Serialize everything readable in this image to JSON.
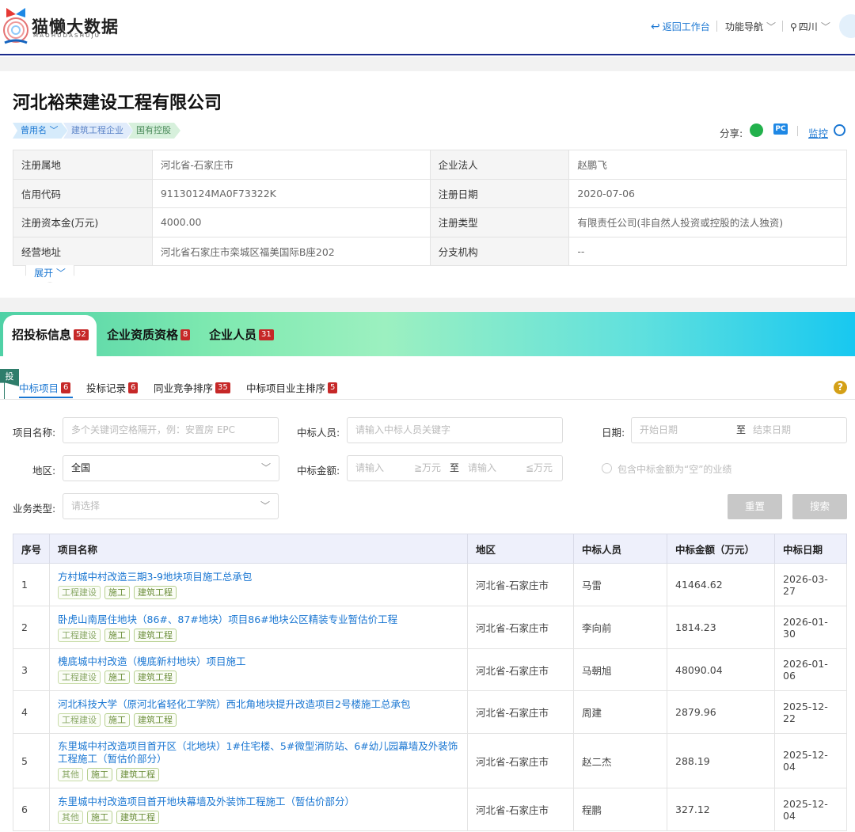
{
  "header": {
    "logo_text": "猫懒大数据",
    "logo_sub": "MAOHUDASHUJU",
    "back_label": "返回工作台",
    "nav_label": "功能导航",
    "region_label": "四川"
  },
  "company": {
    "name": "河北裕荣建设工程有限公司",
    "tags": [
      "曾用名",
      "建筑工程企业",
      "国有控股"
    ],
    "share_label": "分享:",
    "monitor_label": "监控",
    "pc_label": "PC",
    "info": [
      {
        "k1": "注册属地",
        "v1": "河北省-石家庄市",
        "k2": "企业法人",
        "v2": "赵鹏飞"
      },
      {
        "k1": "信用代码",
        "v1": "91130124MA0F73322K",
        "k2": "注册日期",
        "v2": "2020-07-06"
      },
      {
        "k1": "注册资本金(万元)",
        "v1": "4000.00",
        "k2": "注册类型",
        "v2": "有限责任公司(非自然人投资或控股的法人独资)"
      },
      {
        "k1": "经营地址",
        "v1": "河北省石家庄市栾城区福美国际B座202",
        "k2": "分支机构",
        "v2": "--"
      }
    ],
    "expand_label": "展开"
  },
  "main_tabs": [
    {
      "label": "招投标信息",
      "count": "52"
    },
    {
      "label": "企业资质资格",
      "count": "8"
    },
    {
      "label": "企业人员",
      "count": "31"
    }
  ],
  "flag_label": "投",
  "sub_tabs": [
    {
      "label": "中标项目",
      "count": "6"
    },
    {
      "label": "投标记录",
      "count": "6"
    },
    {
      "label": "同业竞争排序",
      "count": "35"
    },
    {
      "label": "中标项目业主排序",
      "count": "5"
    }
  ],
  "filters": {
    "project_name_label": "项目名称:",
    "project_name_placeholder": "多个关键词空格隔开，例：安置房 EPC",
    "winner_label": "中标人员:",
    "winner_placeholder": "请输入中标人员关键字",
    "date_label": "日期:",
    "date_start": "开始日期",
    "date_to": "至",
    "date_end": "结束日期",
    "region_label": "地区:",
    "region_value": "全国",
    "amount_label": "中标金额:",
    "amount_min_placeholder": "请输入",
    "amount_min_unit": "≧万元",
    "amount_to": "至",
    "amount_max_placeholder": "请输入",
    "amount_max_unit": "≦万元",
    "include_empty_label": "包含中标金额为“空”的业绩",
    "biz_type_label": "业务类型:",
    "biz_type_placeholder": "请选择",
    "reset_label": "重置",
    "search_label": "搜索"
  },
  "table": {
    "headers": [
      "序号",
      "项目名称",
      "地区",
      "中标人员",
      "中标金额（万元）",
      "中标日期"
    ],
    "rows": [
      {
        "no": "1",
        "title": "方村城中村改造三期3-9地块项目施工总承包",
        "tags": [
          "工程建设",
          "施工",
          "建筑工程"
        ],
        "region": "河北省-石家庄市",
        "person": "马雷",
        "amount": "41464.62",
        "date": "2026-03-27"
      },
      {
        "no": "2",
        "title": "卧虎山南居住地块（86#、87#地块）项目86#地块公区精装专业暂估价工程",
        "tags": [
          "工程建设",
          "施工",
          "建筑工程"
        ],
        "region": "河北省-石家庄市",
        "person": "李向前",
        "amount": "1814.23",
        "date": "2026-01-30"
      },
      {
        "no": "3",
        "title": "槐底城中村改造（槐底新村地块）项目施工",
        "tags": [
          "工程建设",
          "施工",
          "建筑工程"
        ],
        "region": "河北省-石家庄市",
        "person": "马朝旭",
        "amount": "48090.04",
        "date": "2026-01-06"
      },
      {
        "no": "4",
        "title": "河北科技大学（原河北省轻化工学院）西北角地块提升改造项目2号楼施工总承包",
        "tags": [
          "工程建设",
          "施工",
          "建筑工程"
        ],
        "region": "河北省-石家庄市",
        "person": "周建",
        "amount": "2879.96",
        "date": "2025-12-22"
      },
      {
        "no": "5",
        "title": "东里城中村改造项目首开区（北地块）1#住宅楼、5#微型消防站、6#幼儿园幕墙及外装饰工程施工（暂估价部分）",
        "tags": [
          "其他",
          "施工",
          "建筑工程"
        ],
        "region": "河北省-石家庄市",
        "person": "赵二杰",
        "amount": "288.19",
        "date": "2025-12-04"
      },
      {
        "no": "6",
        "title": "东里城中村改造项目首开地块幕墙及外装饰工程施工（暂估价部分）",
        "tags": [
          "其他",
          "施工",
          "建筑工程"
        ],
        "region": "河北省-石家庄市",
        "person": "程鹏",
        "amount": "327.12",
        "date": "2025-12-04"
      }
    ]
  },
  "colors": {
    "brand_blue": "#1976d2",
    "badge_red": "#c62828",
    "header_border": "#1a2a8c"
  }
}
